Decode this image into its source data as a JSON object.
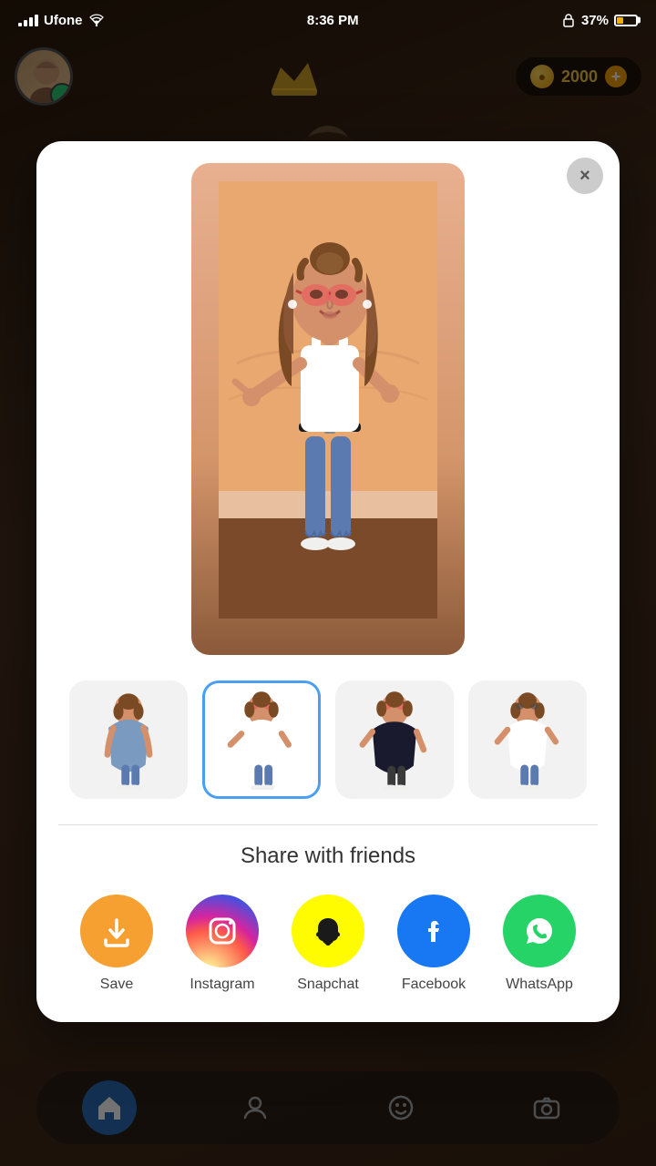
{
  "statusBar": {
    "carrier": "Ufone",
    "time": "8:36 PM",
    "battery": "37%",
    "batteryPct": 37
  },
  "header": {
    "coins": "2000",
    "addLabel": "+"
  },
  "modal": {
    "closeLabel": "×",
    "shareTitle": "Share with friends",
    "shareButtons": [
      {
        "id": "save",
        "label": "Save",
        "colorClass": "save-circle"
      },
      {
        "id": "instagram",
        "label": "Instagram",
        "colorClass": "insta-circle"
      },
      {
        "id": "snapchat",
        "label": "Snapchat",
        "colorClass": "snap-circle"
      },
      {
        "id": "facebook",
        "label": "Facebook",
        "colorClass": "fb-circle"
      },
      {
        "id": "whatsapp",
        "label": "WhatsApp",
        "colorClass": "wa-circle"
      }
    ]
  },
  "thumbnails": [
    {
      "id": "thumb-1",
      "active": false
    },
    {
      "id": "thumb-2",
      "active": true
    },
    {
      "id": "thumb-3",
      "active": false
    },
    {
      "id": "thumb-4",
      "active": false
    }
  ],
  "nav": {
    "items": [
      "home",
      "contacts",
      "emoji",
      "camera"
    ]
  }
}
